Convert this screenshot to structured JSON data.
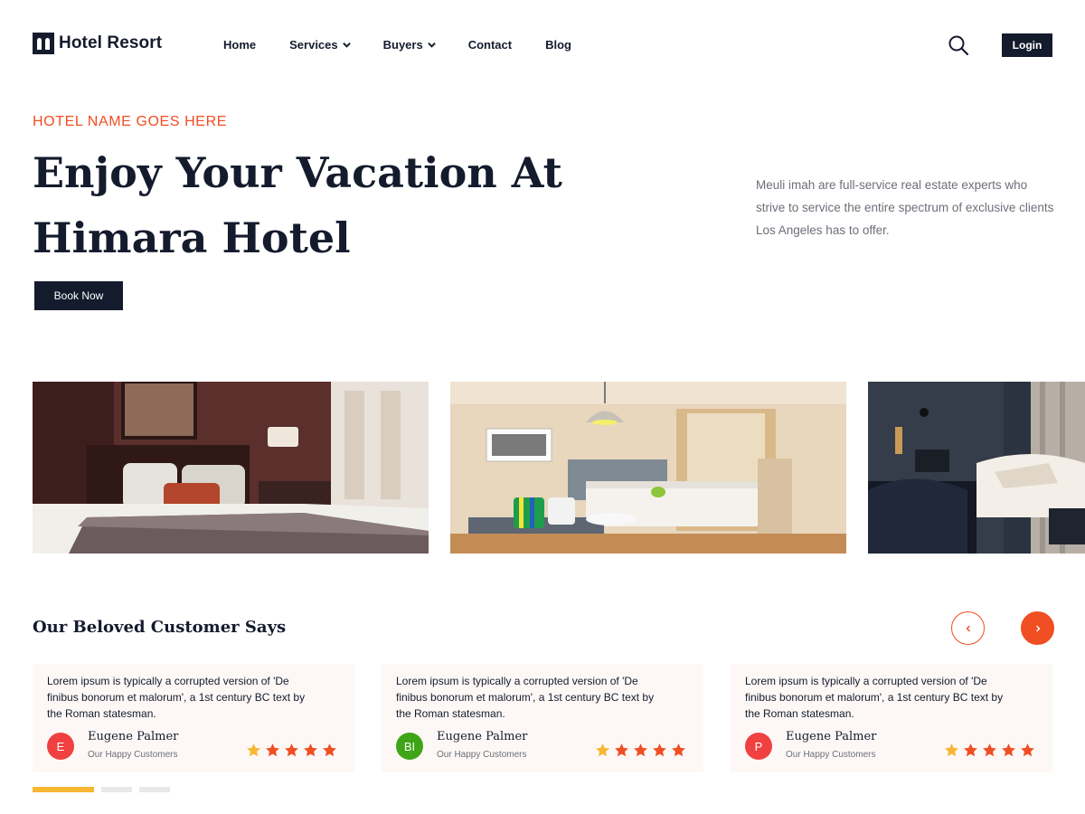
{
  "header": {
    "logo_text": "Hotel Resort",
    "nav": {
      "home": "Home",
      "services": "Services",
      "buyers": "Buyers",
      "contact": "Contact",
      "blog": "Blog"
    },
    "login_label": "Login"
  },
  "hero": {
    "eyebrow": "HOTEL NAME GOES HERE",
    "title_line1": "Enjoy Your Vacation At",
    "title_line2": "Himara Hotel",
    "book_label": "Book Now",
    "description": "Meuli imah are full-service real estate experts who strive to service the entire spectrum of exclusive clients Los Angeles has to offer."
  },
  "testimonials": {
    "title": "Our Beloved Customer Says",
    "prev_icon": "chevron-left-icon",
    "next_icon": "chevron-right-icon",
    "cards": [
      {
        "quote": "Lorem ipsum is typically a corrupted version of 'De finibus bonorum et malorum', a 1st century BC text by the Roman statesman.",
        "initials": "E",
        "avatar_color": "#f04040",
        "name": "Eugene Palmer",
        "role": "Our Happy Customers",
        "rating": 5
      },
      {
        "quote": "Lorem ipsum is typically a corrupted version of 'De finibus bonorum et malorum', a 1st century BC text by the Roman statesman.",
        "initials": "BI",
        "avatar_color": "#3fa516",
        "name": "Eugene Palmer",
        "role": "Our Happy Customers",
        "rating": 5
      },
      {
        "quote": "Lorem ipsum is typically a corrupted version of 'De finibus bonorum et malorum', a 1st century BC text by the Roman statesman.",
        "initials": "P",
        "avatar_color": "#f04040",
        "name": "Eugene Palmer",
        "role": "Our Happy Customers",
        "rating": 5
      }
    ],
    "active_page": 1,
    "page_count": 3
  },
  "colors": {
    "primary": "#141b2d",
    "accent": "#f04e23",
    "star_first": "#f7b733",
    "star": "#f04e23",
    "pager_active": "#f7b733"
  }
}
